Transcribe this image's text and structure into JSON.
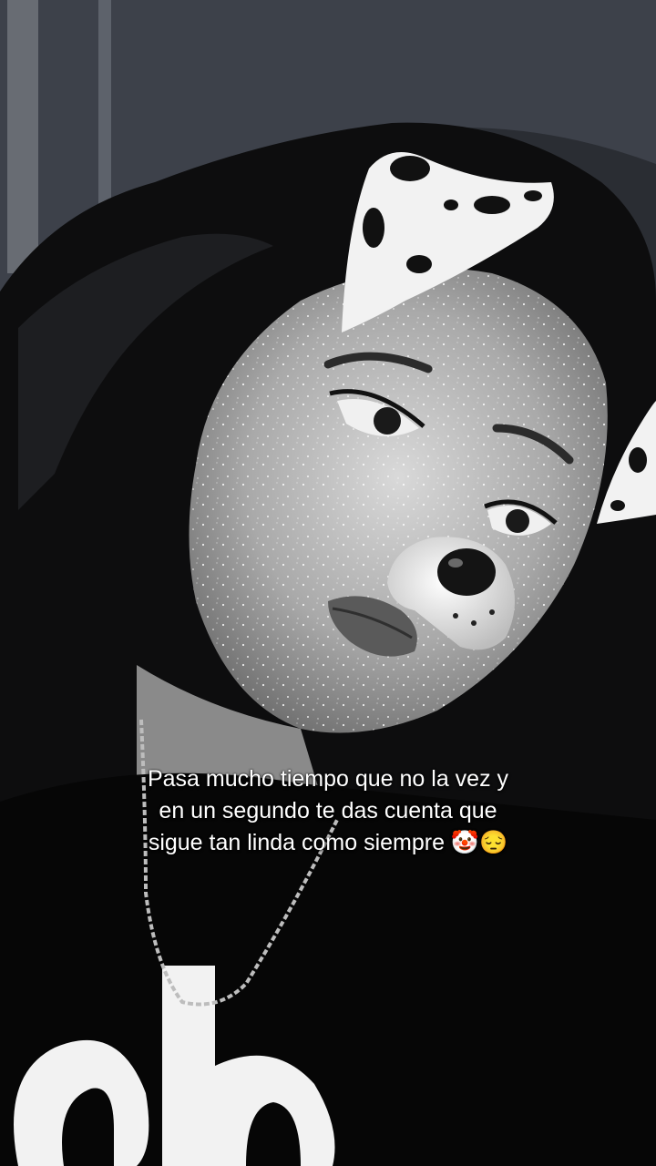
{
  "caption": {
    "lines": [
      "Pasa mucho tiempo  que no la vez y",
      "en un segundo te das cuenta que",
      "sigue tan linda como siempre 🤡😔"
    ]
  },
  "filter": {
    "name": "dalmatian-dog-ears-filter",
    "tone": "black-and-white"
  },
  "colors": {
    "background": "#141518",
    "wall": "#3a3e46",
    "skin": "#c8c8c8",
    "hair": "#0c0c0c",
    "shirt": "#050505",
    "text": "#ffffff"
  }
}
